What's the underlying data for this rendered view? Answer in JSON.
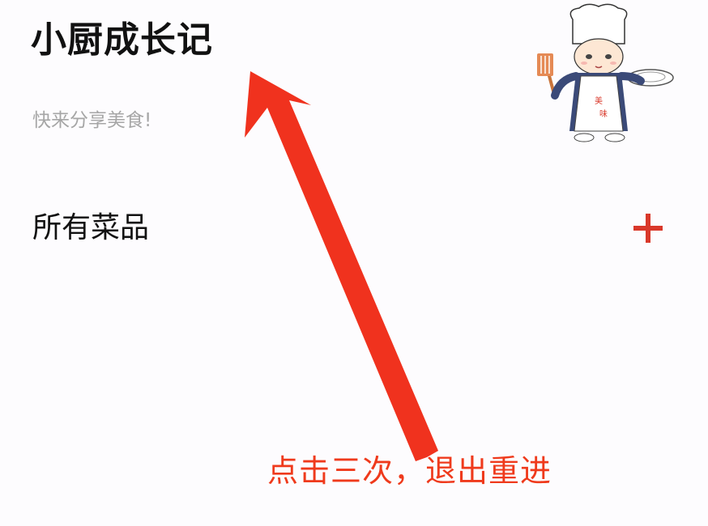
{
  "header": {
    "title": "小厨成长记",
    "subtitle": "快来分享美食!"
  },
  "section": {
    "title": "所有菜品"
  },
  "actions": {
    "add_icon": "plus-icon"
  },
  "annotation": {
    "text": "点击三次，退出重进",
    "color": "#ef3a1c"
  },
  "mascot": {
    "icon": "chef-mascot",
    "apron_text": "美味"
  },
  "colors": {
    "accent": "#d9382a",
    "title": "#111111",
    "subtitle": "#a6a6a6"
  }
}
